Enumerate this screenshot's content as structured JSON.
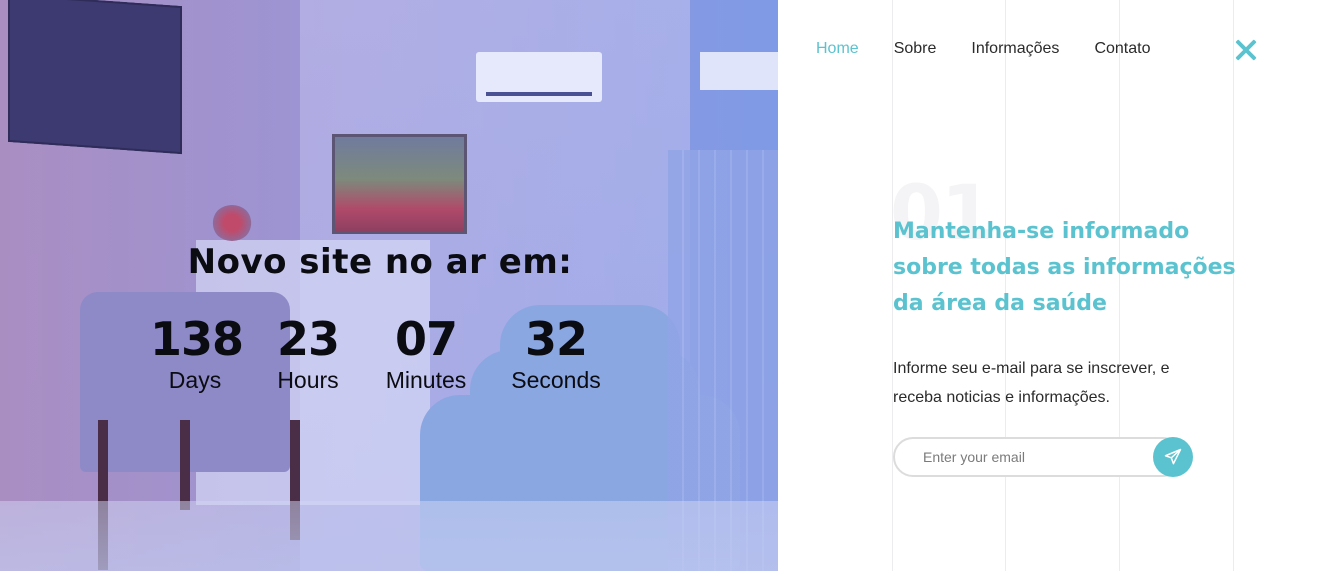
{
  "hero": {
    "title": "Novo site no ar em:",
    "countdown": [
      {
        "value": "138",
        "label": "Days"
      },
      {
        "value": "23",
        "label": "Hours"
      },
      {
        "value": "07",
        "label": "Minutes"
      },
      {
        "value": "32",
        "label": "Seconds"
      }
    ]
  },
  "nav": {
    "items": [
      {
        "label": "Home",
        "active": true
      },
      {
        "label": "Sobre",
        "active": false
      },
      {
        "label": "Informações",
        "active": false
      },
      {
        "label": "Contato",
        "active": false
      }
    ],
    "close_icon": "close-icon"
  },
  "content": {
    "section_number": "01",
    "headline": "Mantenha-se informado sobre todas as informações da área da saúde",
    "description": "Informe seu e-mail para se inscrever, e receba noticias e informações."
  },
  "subscribe": {
    "email_placeholder": "Enter your email",
    "email_value": "",
    "send_icon": "paper-plane-icon"
  },
  "colors": {
    "accent": "#5bc3cf",
    "text": "#2b2b2b"
  }
}
